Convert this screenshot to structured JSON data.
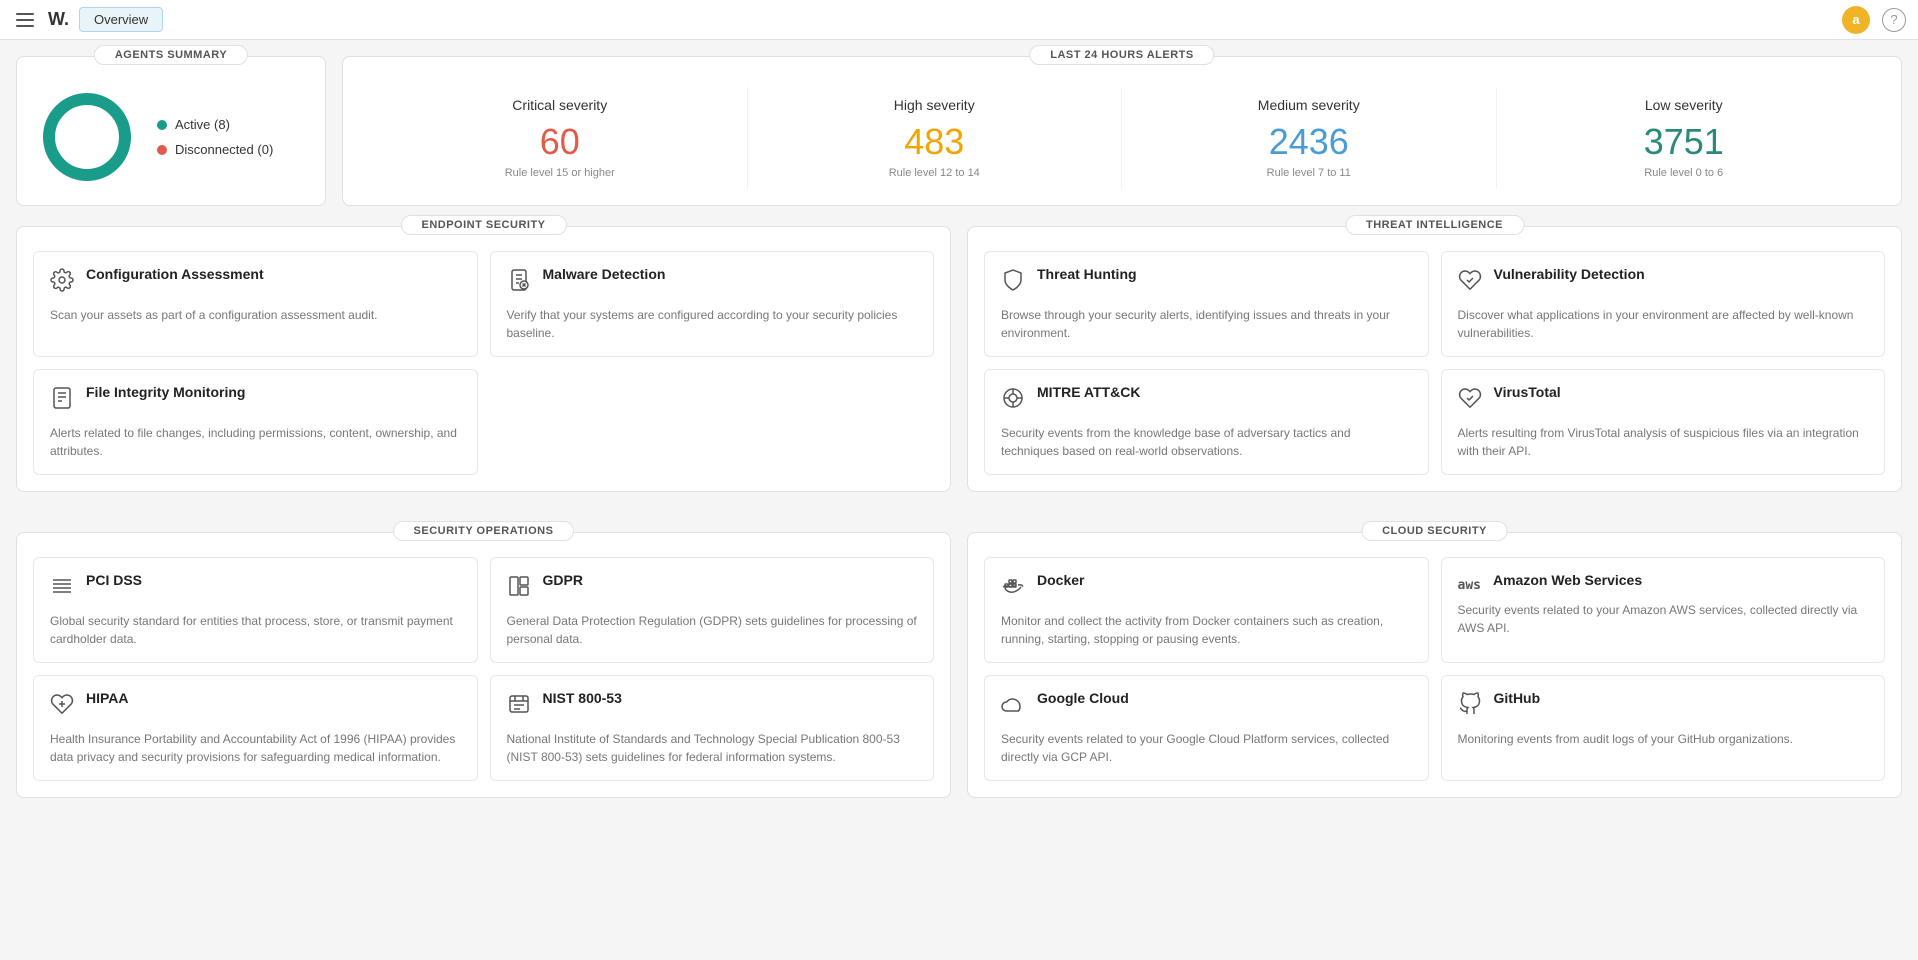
{
  "topbar": {
    "logo": "W.",
    "tab_label": "Overview",
    "avatar_initial": "a",
    "help_symbol": "?"
  },
  "agents_summary": {
    "section_title": "AGENTS SUMMARY",
    "legend": [
      {
        "label": "Active (8)",
        "color": "#1a9c8a"
      },
      {
        "label": "Disconnected (0)",
        "color": "#e05b4b"
      }
    ]
  },
  "alerts": {
    "section_title": "LAST 24 HOURS ALERTS",
    "items": [
      {
        "label": "Critical severity",
        "number": "60",
        "class": "critical",
        "rule": "Rule level 15 or higher"
      },
      {
        "label": "High severity",
        "number": "483",
        "class": "high",
        "rule": "Rule level 12 to 14"
      },
      {
        "label": "Medium severity",
        "number": "2436",
        "class": "medium",
        "rule": "Rule level 7 to 11"
      },
      {
        "label": "Low severity",
        "number": "3751",
        "class": "low",
        "rule": "Rule level 0 to 6"
      }
    ]
  },
  "endpoint_security": {
    "section_title": "ENDPOINT SECURITY",
    "cards": [
      {
        "id": "config-assessment",
        "icon": "⚙",
        "title": "Configuration Assessment",
        "desc": "Scan your assets as part of a configuration assessment audit."
      },
      {
        "id": "malware-detection",
        "icon": "📋",
        "title": "Malware Detection",
        "desc": "Verify that your systems are configured according to your security policies baseline."
      },
      {
        "id": "file-integrity",
        "icon": "📄",
        "title": "File Integrity Monitoring",
        "desc": "Alerts related to file changes, including permissions, content, ownership, and attributes."
      }
    ]
  },
  "threat_intelligence": {
    "section_title": "THREAT INTELLIGENCE",
    "cards": [
      {
        "id": "threat-hunting",
        "icon": "🛡",
        "title": "Threat Hunting",
        "desc": "Browse through your security alerts, identifying issues and threats in your environment."
      },
      {
        "id": "vulnerability-detection",
        "icon": "❤",
        "title": "Vulnerability Detection",
        "desc": "Discover what applications in your environment are affected by well-known vulnerabilities."
      },
      {
        "id": "mitre-attck",
        "icon": "⚙",
        "title": "MITRE ATT&CK",
        "desc": "Security events from the knowledge base of adversary tactics and techniques based on real-world observations."
      },
      {
        "id": "virustotal",
        "icon": "❤",
        "title": "VirusTotal",
        "desc": "Alerts resulting from VirusTotal analysis of suspicious files via an integration with their API."
      }
    ]
  },
  "security_operations": {
    "section_title": "SECURITY OPERATIONS",
    "cards": [
      {
        "id": "pci-dss",
        "icon": "☰",
        "title": "PCI DSS",
        "desc": "Global security standard for entities that process, store, or transmit payment cardholder data."
      },
      {
        "id": "gdpr",
        "icon": "📊",
        "title": "GDPR",
        "desc": "General Data Protection Regulation (GDPR) sets guidelines for processing of personal data."
      },
      {
        "id": "hipaa",
        "icon": "❤",
        "title": "HIPAA",
        "desc": "Health Insurance Portability and Accountability Act of 1996 (HIPAA) provides data privacy and security provisions for safeguarding medical information."
      },
      {
        "id": "nist-800-53",
        "icon": "📅",
        "title": "NIST 800-53",
        "desc": "National Institute of Standards and Technology Special Publication 800-53 (NIST 800-53) sets guidelines for federal information systems."
      }
    ]
  },
  "cloud_security": {
    "section_title": "CLOUD SECURITY",
    "cards": [
      {
        "id": "docker",
        "icon": "🐳",
        "title": "Docker",
        "desc": "Monitor and collect the activity from Docker containers such as creation, running, starting, stopping or pausing events."
      },
      {
        "id": "aws",
        "icon": "aws",
        "title": "Amazon Web Services",
        "desc": "Security events related to your Amazon AWS services, collected directly via AWS API."
      },
      {
        "id": "google-cloud",
        "icon": "☁",
        "title": "Google Cloud",
        "desc": "Security events related to your Google Cloud Platform services, collected directly via GCP API."
      },
      {
        "id": "github",
        "icon": "⊙",
        "title": "GitHub",
        "desc": "Monitoring events from audit logs of your GitHub organizations."
      }
    ]
  }
}
